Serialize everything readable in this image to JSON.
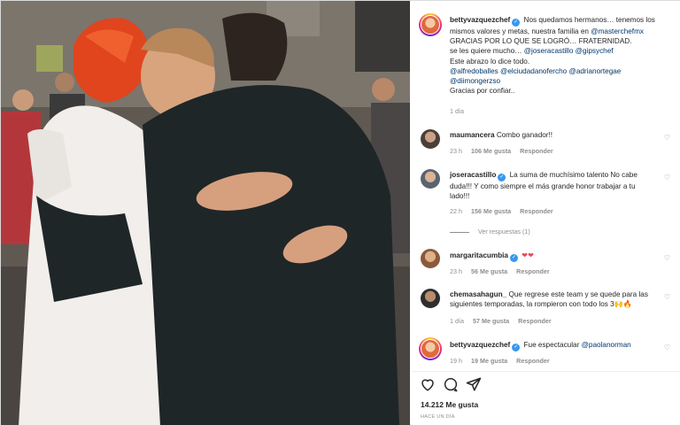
{
  "post": {
    "author": "bettyvazquezchef",
    "caption_lines": [
      {
        "text": "Nos quedamos hermanos… tenemos los",
        "type": "text"
      },
      {
        "text": "mismos valores y metas, nuestra familia en ",
        "mention": "@masterchefmx"
      },
      {
        "text": "GRACIAS POR LO QUE SE LOGRÓ… FRATERNIDAD.",
        "type": "text"
      },
      {
        "text": "se les quiere mucho… ",
        "mention": "@joseracastillo @gipsychef"
      },
      {
        "text": "Este abrazo lo dice todo.",
        "type": "text"
      },
      {
        "mention": "@alfredoballes @elciudadanofercho @adrianortegae"
      },
      {
        "mention": "@diimongerzso"
      },
      {
        "text": "Gracias por confiar..",
        "type": "text"
      }
    ],
    "time": "1 día"
  },
  "comments": [
    {
      "user": "maumancera",
      "text": "Combo ganador!!",
      "time": "23 h",
      "likes": "106 Me gusta",
      "reply": "Responder"
    },
    {
      "user": "joseracastillo",
      "verified": true,
      "lines": [
        "La suma de muchísimo talento No cabe",
        "duda!!! Y como siempre el más grande honor trabajar a tu",
        "lado!!!"
      ],
      "time": "22 h",
      "likes": "156 Me gusta",
      "reply": "Responder",
      "view_replies": "Ver respuestas (1)"
    },
    {
      "user": "margaritacumbia",
      "verified": true,
      "text": "",
      "emoji": "❤❤",
      "time": "23 h",
      "likes": "56 Me gusta",
      "reply": "Responder"
    },
    {
      "user": "chemasahagun_",
      "lines": [
        "Que regrese este team y se quede para las",
        "siguientes temporadas, la rompieron con todo los 3🙌🔥"
      ],
      "time": "1 día",
      "likes": "57 Me gusta",
      "reply": "Responder"
    },
    {
      "user": "bettyvazquezchef",
      "verified": true,
      "text": "Fue espectacular ",
      "mention": "@paolanorman",
      "time": "19 h",
      "likes": "19 Me gusta",
      "reply": "Responder"
    }
  ],
  "footer": {
    "likes": "14.212 Me gusta",
    "ago": "HACE UN DÍA"
  },
  "icons": [
    "heart-icon",
    "comment-icon",
    "share-icon",
    "verified-icon"
  ],
  "colors": {
    "mention": "#00376b",
    "verified": "#3897f0",
    "heart": "#ed4956",
    "muted": "#8e8e8e"
  }
}
